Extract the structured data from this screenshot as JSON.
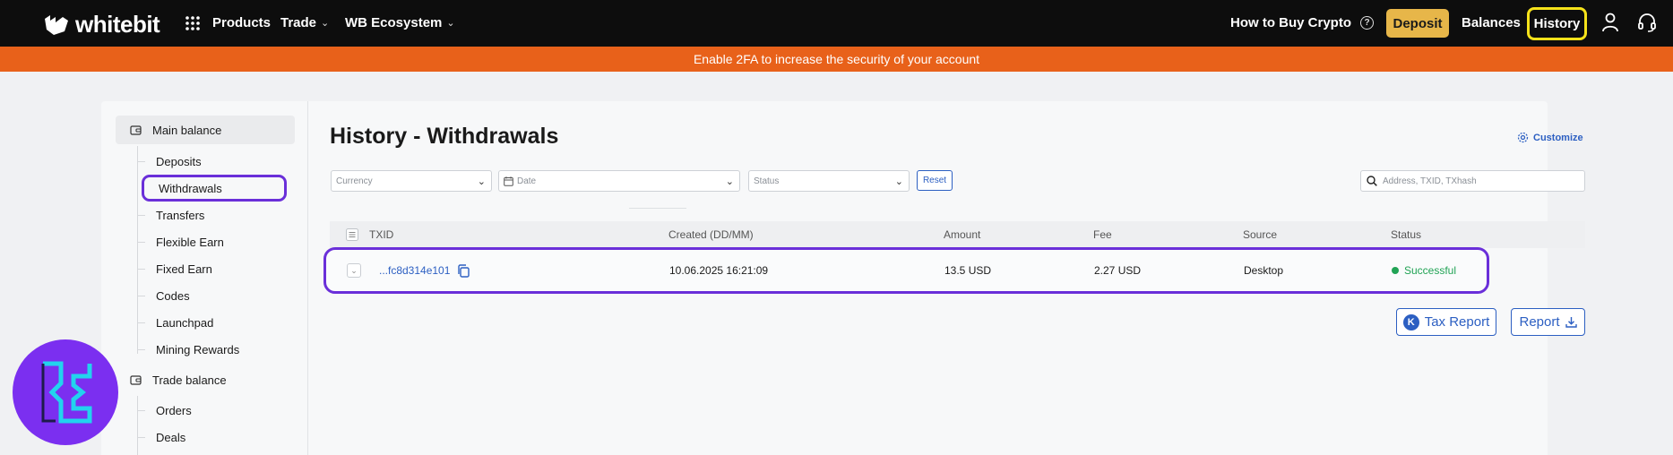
{
  "topbar": {
    "logo_text": "whitebit",
    "nav": [
      {
        "label": "Products",
        "icon": "grid-icon"
      },
      {
        "label": "Trade",
        "icon": "chevron-down-icon"
      },
      {
        "label": "WB Ecosystem",
        "icon": "chevron-down-icon"
      }
    ],
    "how_to_buy": "How to Buy Crypto",
    "deposit": "Deposit",
    "balances": "Balances",
    "history": "History",
    "colors": {
      "deposit_bg": "#e7b649",
      "history_highlight": "#f5e21a"
    }
  },
  "banner": {
    "text": "Enable 2FA to increase the security of your account",
    "color": "#e8611a"
  },
  "sidebar": {
    "main_balance": {
      "label": "Main balance",
      "items": [
        "Deposits",
        "Withdrawals",
        "Transfers",
        "Flexible Earn",
        "Fixed Earn",
        "Codes",
        "Launchpad",
        "Mining Rewards"
      ],
      "selected": "Withdrawals"
    },
    "trade_balance": {
      "label": "Trade balance",
      "items": [
        "Orders",
        "Deals"
      ]
    }
  },
  "main": {
    "title": "History - Withdrawals",
    "customize": "Customize",
    "filters": {
      "currency_placeholder": "Currency",
      "date_placeholder": "Date",
      "status_placeholder": "Status",
      "reset": "Reset",
      "search_placeholder": "Address, TXID, TXhash"
    },
    "table": {
      "columns": [
        "TXID",
        "Created (DD/MM)",
        "Amount",
        "Fee",
        "Source",
        "Status"
      ],
      "rows": [
        {
          "txid": "...fc8d314e101",
          "created": "10.06.2025 16:21:09",
          "amount": "13.5 USD",
          "fee": "2.27 USD",
          "source": "Desktop",
          "status": "Successful"
        }
      ]
    },
    "tax_report": "Tax Report",
    "report": "Report",
    "accent_color": "#2c5fc2",
    "highlight_color": "#6a2fd9"
  }
}
